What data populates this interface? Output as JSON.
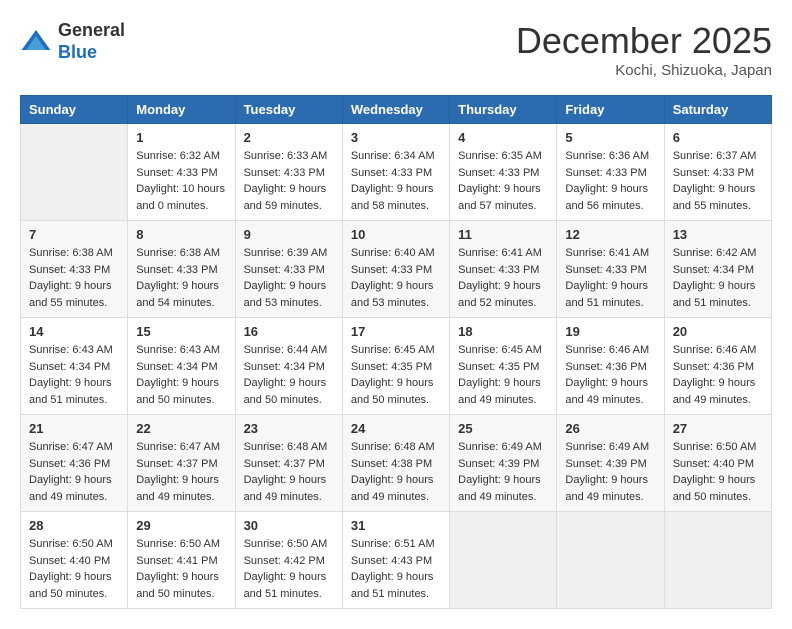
{
  "header": {
    "logo_general": "General",
    "logo_blue": "Blue",
    "month_title": "December 2025",
    "location": "Kochi, Shizuoka, Japan"
  },
  "days_of_week": [
    "Sunday",
    "Monday",
    "Tuesday",
    "Wednesday",
    "Thursday",
    "Friday",
    "Saturday"
  ],
  "weeks": [
    [
      null,
      {
        "day": "1",
        "sunrise": "6:32 AM",
        "sunset": "4:33 PM",
        "daylight": "10 hours and 0 minutes."
      },
      {
        "day": "2",
        "sunrise": "6:33 AM",
        "sunset": "4:33 PM",
        "daylight": "9 hours and 59 minutes."
      },
      {
        "day": "3",
        "sunrise": "6:34 AM",
        "sunset": "4:33 PM",
        "daylight": "9 hours and 58 minutes."
      },
      {
        "day": "4",
        "sunrise": "6:35 AM",
        "sunset": "4:33 PM",
        "daylight": "9 hours and 57 minutes."
      },
      {
        "day": "5",
        "sunrise": "6:36 AM",
        "sunset": "4:33 PM",
        "daylight": "9 hours and 56 minutes."
      },
      {
        "day": "6",
        "sunrise": "6:37 AM",
        "sunset": "4:33 PM",
        "daylight": "9 hours and 55 minutes."
      }
    ],
    [
      {
        "day": "7",
        "sunrise": "6:38 AM",
        "sunset": "4:33 PM",
        "daylight": "9 hours and 55 minutes."
      },
      {
        "day": "8",
        "sunrise": "6:38 AM",
        "sunset": "4:33 PM",
        "daylight": "9 hours and 54 minutes."
      },
      {
        "day": "9",
        "sunrise": "6:39 AM",
        "sunset": "4:33 PM",
        "daylight": "9 hours and 53 minutes."
      },
      {
        "day": "10",
        "sunrise": "6:40 AM",
        "sunset": "4:33 PM",
        "daylight": "9 hours and 53 minutes."
      },
      {
        "day": "11",
        "sunrise": "6:41 AM",
        "sunset": "4:33 PM",
        "daylight": "9 hours and 52 minutes."
      },
      {
        "day": "12",
        "sunrise": "6:41 AM",
        "sunset": "4:33 PM",
        "daylight": "9 hours and 51 minutes."
      },
      {
        "day": "13",
        "sunrise": "6:42 AM",
        "sunset": "4:34 PM",
        "daylight": "9 hours and 51 minutes."
      }
    ],
    [
      {
        "day": "14",
        "sunrise": "6:43 AM",
        "sunset": "4:34 PM",
        "daylight": "9 hours and 51 minutes."
      },
      {
        "day": "15",
        "sunrise": "6:43 AM",
        "sunset": "4:34 PM",
        "daylight": "9 hours and 50 minutes."
      },
      {
        "day": "16",
        "sunrise": "6:44 AM",
        "sunset": "4:34 PM",
        "daylight": "9 hours and 50 minutes."
      },
      {
        "day": "17",
        "sunrise": "6:45 AM",
        "sunset": "4:35 PM",
        "daylight": "9 hours and 50 minutes."
      },
      {
        "day": "18",
        "sunrise": "6:45 AM",
        "sunset": "4:35 PM",
        "daylight": "9 hours and 49 minutes."
      },
      {
        "day": "19",
        "sunrise": "6:46 AM",
        "sunset": "4:36 PM",
        "daylight": "9 hours and 49 minutes."
      },
      {
        "day": "20",
        "sunrise": "6:46 AM",
        "sunset": "4:36 PM",
        "daylight": "9 hours and 49 minutes."
      }
    ],
    [
      {
        "day": "21",
        "sunrise": "6:47 AM",
        "sunset": "4:36 PM",
        "daylight": "9 hours and 49 minutes."
      },
      {
        "day": "22",
        "sunrise": "6:47 AM",
        "sunset": "4:37 PM",
        "daylight": "9 hours and 49 minutes."
      },
      {
        "day": "23",
        "sunrise": "6:48 AM",
        "sunset": "4:37 PM",
        "daylight": "9 hours and 49 minutes."
      },
      {
        "day": "24",
        "sunrise": "6:48 AM",
        "sunset": "4:38 PM",
        "daylight": "9 hours and 49 minutes."
      },
      {
        "day": "25",
        "sunrise": "6:49 AM",
        "sunset": "4:39 PM",
        "daylight": "9 hours and 49 minutes."
      },
      {
        "day": "26",
        "sunrise": "6:49 AM",
        "sunset": "4:39 PM",
        "daylight": "9 hours and 49 minutes."
      },
      {
        "day": "27",
        "sunrise": "6:50 AM",
        "sunset": "4:40 PM",
        "daylight": "9 hours and 50 minutes."
      }
    ],
    [
      {
        "day": "28",
        "sunrise": "6:50 AM",
        "sunset": "4:40 PM",
        "daylight": "9 hours and 50 minutes."
      },
      {
        "day": "29",
        "sunrise": "6:50 AM",
        "sunset": "4:41 PM",
        "daylight": "9 hours and 50 minutes."
      },
      {
        "day": "30",
        "sunrise": "6:50 AM",
        "sunset": "4:42 PM",
        "daylight": "9 hours and 51 minutes."
      },
      {
        "day": "31",
        "sunrise": "6:51 AM",
        "sunset": "4:43 PM",
        "daylight": "9 hours and 51 minutes."
      },
      null,
      null,
      null
    ]
  ],
  "labels": {
    "sunrise_label": "Sunrise:",
    "sunset_label": "Sunset:",
    "daylight_label": "Daylight:"
  }
}
